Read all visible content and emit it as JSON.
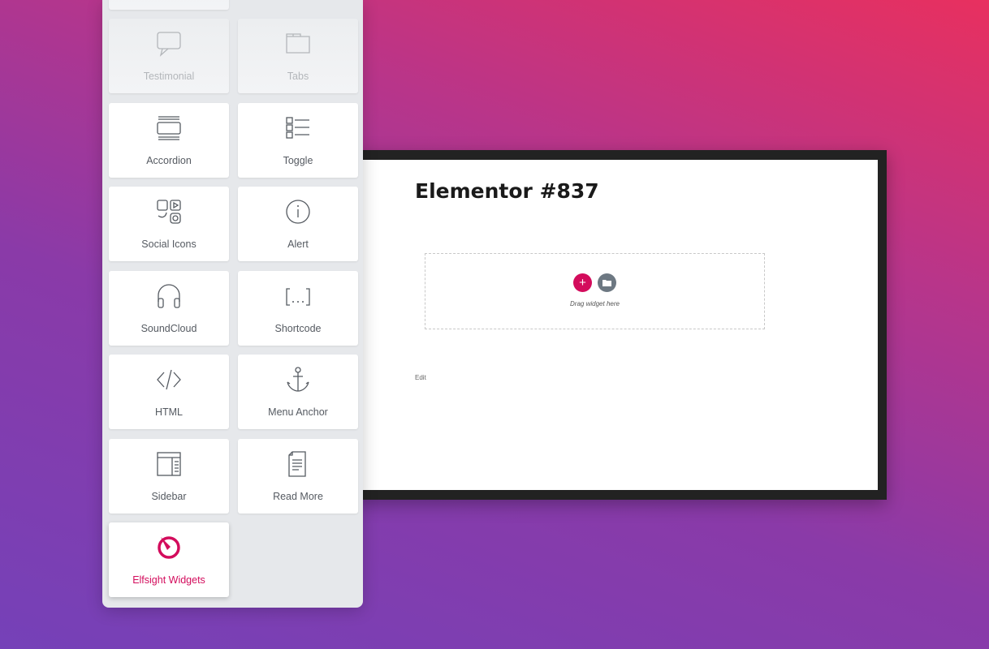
{
  "panel": {
    "widgets": [
      {
        "label": "Testimonial",
        "icon": "speech-bubble-icon",
        "state": "faded"
      },
      {
        "label": "Tabs",
        "icon": "folder-tabs-icon",
        "state": "faded"
      },
      {
        "label": "Accordion",
        "icon": "accordion-icon"
      },
      {
        "label": "Toggle",
        "icon": "toggle-list-icon"
      },
      {
        "label": "Social Icons",
        "icon": "social-icons-icon"
      },
      {
        "label": "Alert",
        "icon": "info-circle-icon"
      },
      {
        "label": "SoundCloud",
        "icon": "headphones-icon"
      },
      {
        "label": "Shortcode",
        "icon": "shortcode-brackets-icon"
      },
      {
        "label": "HTML",
        "icon": "code-icon"
      },
      {
        "label": "Menu Anchor",
        "icon": "anchor-icon"
      },
      {
        "label": "Sidebar",
        "icon": "sidebar-layout-icon"
      },
      {
        "label": "Read More",
        "icon": "document-icon"
      },
      {
        "label": "Elfsight Widgets",
        "icon": "elfsight-logo-icon",
        "state": "accent"
      }
    ]
  },
  "canvas": {
    "title": "Elementor #837",
    "drop_text": "Drag widget here",
    "add_icon": "+",
    "edit_link": "Edit"
  },
  "colors": {
    "accent": "#d30c5c",
    "template_button": "#6d7882"
  }
}
